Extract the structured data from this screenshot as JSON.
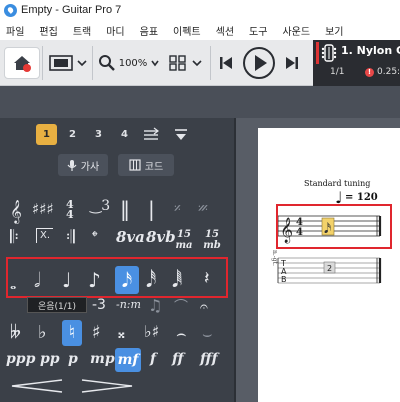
{
  "window": {
    "title": "Empty - Guitar Pro 7"
  },
  "menu": [
    "파일",
    "편집",
    "트랙",
    "마디",
    "음표",
    "이펙트",
    "섹션",
    "도구",
    "사운드",
    "보기"
  ],
  "toolbar": {
    "zoom": "100%"
  },
  "track": {
    "name": "1. Nylon Guitar",
    "bar": "1/1",
    "time": "0.25:4",
    "error": "!"
  },
  "palette": {
    "voices": [
      "1",
      "2",
      "3",
      "4"
    ],
    "active_voice": "1",
    "lyrics_label": "가사",
    "chords_label": "코드",
    "tooltip": "온음(1/1)",
    "ottava": [
      "8va",
      "8vb",
      "15ma",
      "15mb"
    ],
    "dynamics": [
      "ppp",
      "pp",
      "p",
      "mp",
      "mf",
      "f",
      "ff",
      "fff"
    ],
    "active_dynamic": "mf",
    "highlight_color": "#e0262e",
    "accent_color": "#4a90e2"
  },
  "score": {
    "tuning": "Standard tuning",
    "tempo": "= 120",
    "time_sig_top": "4",
    "time_sig_bottom": "4",
    "tab_letters": [
      "T",
      "A",
      "B"
    ],
    "fret": "2",
    "instrument_abbr": "n.-gt."
  }
}
